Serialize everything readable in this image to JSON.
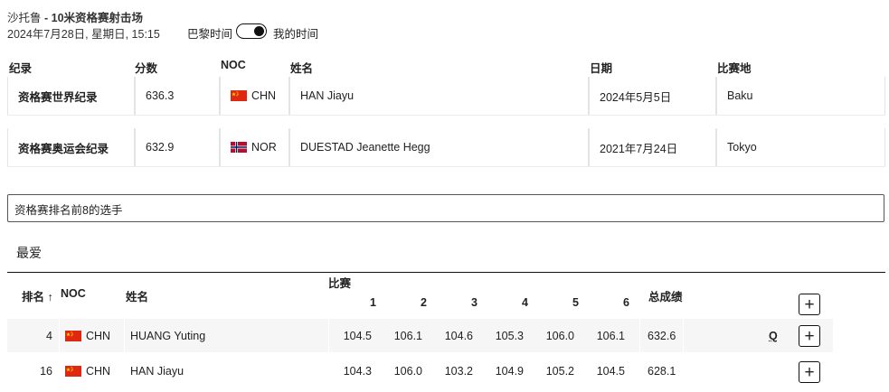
{
  "header": {
    "venue": "沙托鲁",
    "separator": " - ",
    "event": "10米资格赛射击场",
    "datetime": "2024年7月28日, 星期日, 15:15",
    "timezone_left": "巴黎时间",
    "timezone_right": "我的时间",
    "toggle_state": "on"
  },
  "records": {
    "columns": [
      "纪录",
      "分数",
      "NOC",
      "姓名",
      "日期",
      "比赛地"
    ],
    "rows": [
      {
        "record": "资格赛世界纪录",
        "score": "636.3",
        "noc": "CHN",
        "flag": "china",
        "name": "HAN Jiayu",
        "date": "2024年5月5日",
        "venue": "Baku"
      },
      {
        "record": "资格赛奥运会纪录",
        "score": "632.9",
        "noc": "NOR",
        "flag": "norway",
        "name": "DUESTAD Jeanette Hegg",
        "date": "2021年7月24日",
        "venue": "Tokyo"
      }
    ]
  },
  "filter": {
    "value": "资格赛排名前8的选手"
  },
  "favorites": {
    "label": "最爱"
  },
  "results": {
    "headers": {
      "rank": "排名",
      "sort_indicator": "↑",
      "noc": "NOC",
      "name": "姓名",
      "match": "比赛",
      "series": [
        "1",
        "2",
        "3",
        "4",
        "5",
        "6"
      ],
      "total": "总成绩"
    },
    "rows": [
      {
        "rank": "4",
        "noc": "CHN",
        "flag": "china",
        "name": "HUANG Yuting",
        "series": [
          "104.5",
          "106.1",
          "104.6",
          "105.3",
          "106.0",
          "106.1"
        ],
        "total": "632.6",
        "qualification": "Q"
      },
      {
        "rank": "16",
        "noc": "CHN",
        "flag": "china",
        "name": "HAN Jiayu",
        "series": [
          "104.3",
          "106.0",
          "103.2",
          "104.9",
          "105.2",
          "104.5"
        ],
        "total": "628.1",
        "qualification": ""
      }
    ],
    "expand_symbol": "+"
  },
  "colors": {
    "china_red": "#de2910",
    "china_yellow": "#ffde00",
    "norway_red": "#ba0c2f",
    "norway_blue": "#00205b"
  }
}
